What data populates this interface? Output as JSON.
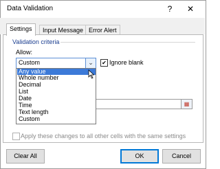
{
  "window": {
    "title": "Data Validation",
    "help": "?",
    "close": "✕"
  },
  "tabs": [
    {
      "label": "Settings",
      "active": true
    },
    {
      "label": "Input Message",
      "active": false
    },
    {
      "label": "Error Alert",
      "active": false
    }
  ],
  "settings": {
    "section_title": "Validation criteria",
    "allow_label": "Allow:",
    "allow_value": "Custom",
    "ignore_blank_label": "Ignore blank",
    "ignore_blank_checked": true,
    "dropdown_options": [
      "Any value",
      "Whole number",
      "Decimal",
      "List",
      "Date",
      "Time",
      "Text length",
      "Custom"
    ],
    "dropdown_highlighted": "Any value",
    "apply_all_label": "Apply these changes to all other cells with the same settings",
    "apply_all_checked": false
  },
  "buttons": {
    "clear_all": "Clear All",
    "ok": "OK",
    "cancel": "Cancel"
  },
  "icons": {
    "close": "close-icon",
    "help": "help-icon",
    "dropdown": "chevron-down-icon",
    "range_select": "range-select-icon",
    "cursor": "mouse-pointer-icon"
  }
}
